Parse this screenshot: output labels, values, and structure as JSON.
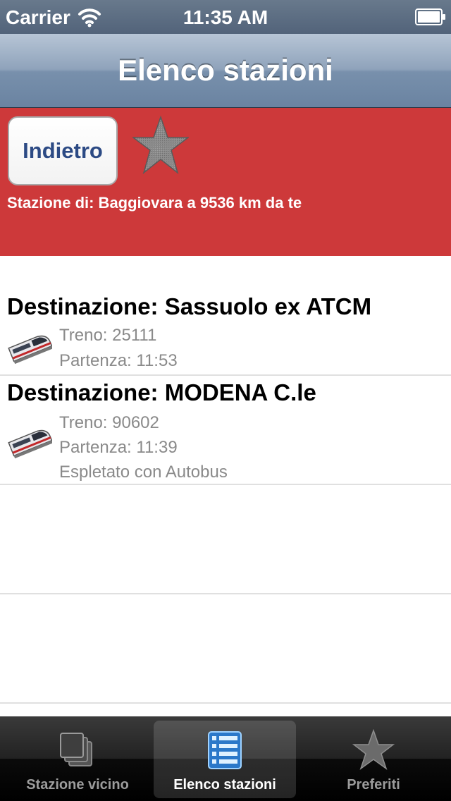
{
  "status_bar": {
    "carrier": "Carrier",
    "time": "11:35 AM"
  },
  "nav": {
    "title": "Elenco stazioni"
  },
  "header": {
    "back_label": "Indietro",
    "favorite_icon": "star-icon",
    "station_info": "Stazione di: Baggiovara a 9536 km da te",
    "background_color": "#cd393a"
  },
  "trains": [
    {
      "destination": "Destinazione: Sassuolo ex ATCM",
      "train": "Treno: 25111",
      "departure": "Partenza: 11:53",
      "icon": "train-icon"
    },
    {
      "destination": "Destinazione: MODENA C.le",
      "train": "Treno: 90602",
      "departure": "Partenza: 11:39",
      "note": "Espletato con Autobus",
      "icon": "train-icon"
    }
  ],
  "tab_bar": {
    "tabs": [
      {
        "label": "Stazione vicino",
        "icon": "stacked-windows-icon",
        "selected": false
      },
      {
        "label": "Elenco stazioni",
        "icon": "list-icon",
        "selected": true
      },
      {
        "label": "Preferiti",
        "icon": "star-icon",
        "selected": false
      }
    ]
  }
}
